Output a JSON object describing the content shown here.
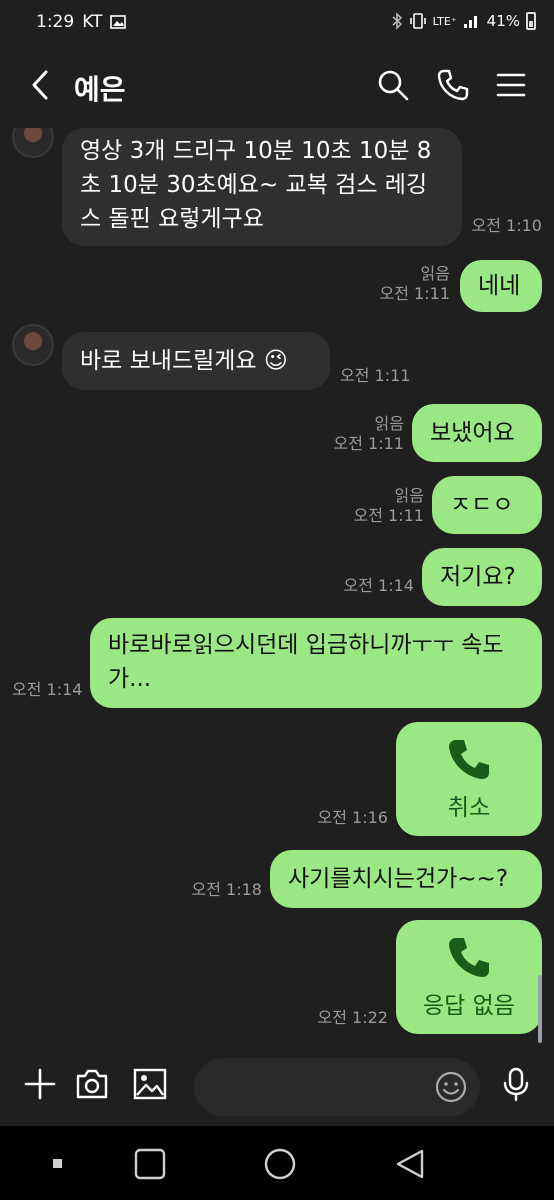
{
  "status": {
    "time": "1:29",
    "carrier": "KT",
    "network": "LTE⁺",
    "battery": "41%"
  },
  "header": {
    "title": "예은"
  },
  "messages": [
    {
      "text": "영상 3개 드리구 10분 10초 10분 8초 10분 30초예요~ 교복 검스 레깅스 돌핀 요렇게구요",
      "time": "오전 1:10"
    },
    {
      "text": "네네",
      "read": "읽음",
      "time": "오전 1:11"
    },
    {
      "text": "바로 보내드릴게요 😉",
      "time": "오전 1:11"
    },
    {
      "text": "보냈어요",
      "read": "읽음",
      "time": "오전 1:11"
    },
    {
      "text": "ㅈㄷㅇ",
      "read": "읽음",
      "time": "오전 1:11"
    },
    {
      "text": "저기요?",
      "time": "오전 1:14"
    },
    {
      "text": "바로바로읽으시던데 입금하니까ㅜㅜ 속도가...",
      "time": "오전 1:14"
    },
    {
      "text": "취소",
      "time": "오전 1:16"
    },
    {
      "text": "사기를치시는건가~~?",
      "time": "오전 1:18"
    },
    {
      "text": "응답 없음",
      "time": "오전 1:22"
    }
  ],
  "input": {
    "placeholder": ""
  },
  "colors": {
    "background": "#1f1f1f",
    "incoming_bubble": "#2f2f2f",
    "outgoing_bubble": "#9be783",
    "call_icon": "#1a5b1a"
  },
  "icons": [
    "back-arrow-icon",
    "search-icon",
    "phone-icon",
    "menu-icon",
    "plus-icon",
    "camera-icon",
    "image-icon",
    "emoji-icon",
    "mic-icon"
  ]
}
